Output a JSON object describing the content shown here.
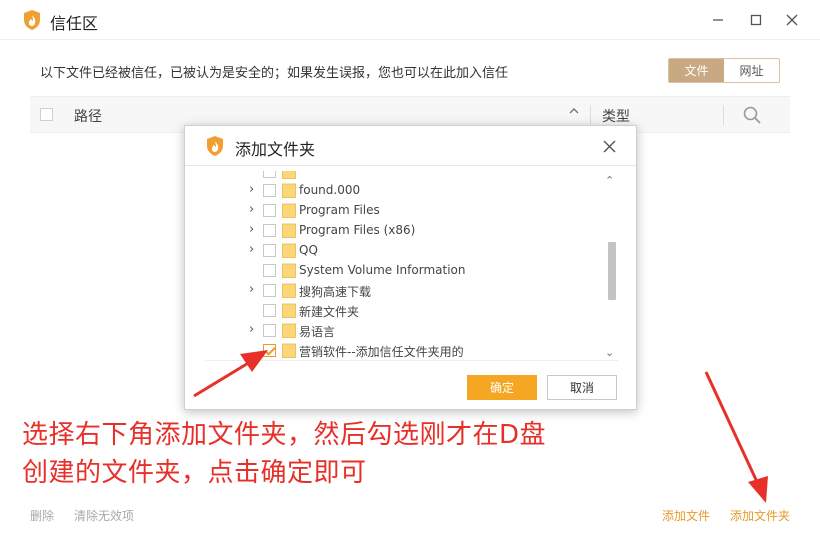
{
  "window": {
    "title": "信任区",
    "minimize_icon": "minimize-icon",
    "maximize_icon": "maximize-icon",
    "close_icon": "close-icon"
  },
  "info": {
    "text": "以下文件已经被信任，已被认为是安全的；如果发生误报，您也可以在此加入信任"
  },
  "segmented": {
    "file_label": "文件",
    "url_label": "网址",
    "selected": "文件"
  },
  "table": {
    "columns": [
      "路径",
      "类型"
    ],
    "path_header": "路径",
    "type_header": "类型",
    "sort_icon": "chevron-up-icon",
    "search_icon": "search-icon"
  },
  "footer": {
    "delete_label": "删除",
    "clean_label": "清除无效项",
    "add_file_label": "添加文件",
    "add_folder_label": "添加文件夹"
  },
  "dialog": {
    "title": "添加文件夹",
    "items": [
      {
        "label": "found.000",
        "expandable": true,
        "checked": false
      },
      {
        "label": "Program Files",
        "expandable": true,
        "checked": false
      },
      {
        "label": "Program Files (x86)",
        "expandable": true,
        "checked": false
      },
      {
        "label": "QQ",
        "expandable": true,
        "checked": false
      },
      {
        "label": "System Volume Information",
        "expandable": false,
        "checked": false
      },
      {
        "label": "搜狗高速下载",
        "expandable": true,
        "checked": false
      },
      {
        "label": "新建文件夹",
        "expandable": false,
        "checked": false
      },
      {
        "label": "易语言",
        "expandable": true,
        "checked": false
      },
      {
        "label": "营销软件--添加信任文件夹用的",
        "expandable": false,
        "checked": true
      }
    ],
    "ok_label": "确定",
    "cancel_label": "取消"
  },
  "annotation": {
    "line1": "选择右下角添加文件夹，然后勾选刚才在D盘",
    "line2": "创建的文件夹，点击确定即可"
  },
  "colors": {
    "accent": "#f5a623",
    "link_orange": "#e79a2a",
    "segment_active": "#c9a983",
    "annotation_red": "#e8302a"
  }
}
